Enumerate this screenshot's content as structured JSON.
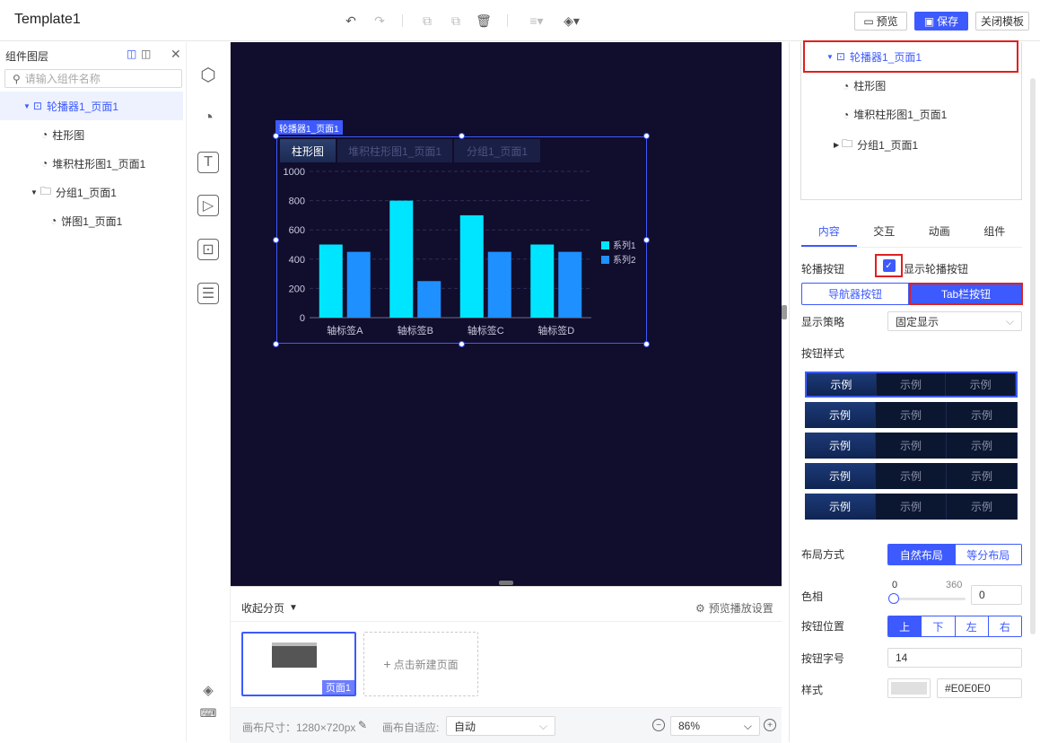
{
  "app": {
    "title": "Template1"
  },
  "topbar": {
    "preview_label": "预览",
    "save_label": "保存",
    "close_label": "关闭模板"
  },
  "leftpanel": {
    "title": "组件图层",
    "search_placeholder": "请输入组件名称",
    "tree": [
      {
        "label": "轮播器1_页面1"
      },
      {
        "label": "柱形图"
      },
      {
        "label": "堆积柱形图1_页面1"
      },
      {
        "label": "分组1_页面1"
      },
      {
        "label": "饼图1_页面1"
      }
    ]
  },
  "canvas": {
    "component_tag": "轮播器1_页面1",
    "tabs": [
      "柱形图",
      "堆积柱形图1_页面1",
      "分组1_页面1"
    ]
  },
  "chart_data": {
    "type": "bar",
    "categories": [
      "轴标签A",
      "轴标签B",
      "轴标签C",
      "轴标签D"
    ],
    "series": [
      {
        "name": "系列1",
        "values": [
          500,
          800,
          700,
          500
        ],
        "color": "#00e5ff"
      },
      {
        "name": "系列2",
        "values": [
          450,
          250,
          450,
          450
        ],
        "color": "#1e90ff"
      }
    ],
    "yticks": [
      "0",
      "200",
      "400",
      "600",
      "800",
      "1000"
    ],
    "ylim": [
      0,
      1000
    ],
    "legend": "right",
    "grid": true
  },
  "pages": {
    "collapse_label": "收起分页",
    "settings_label": "预览播放设置",
    "page_label": "页面1",
    "new_page_label": "点击新建页面"
  },
  "footer": {
    "canvas_size_label": "画布尺寸：1280×720px",
    "adapt_label": "画布自适应:",
    "adapt_value": "自动",
    "zoom_value": "86%"
  },
  "rightpanel": {
    "tree": [
      {
        "label": "轮播器1_页面1"
      },
      {
        "label": "柱形图"
      },
      {
        "label": "堆积柱形图1_页面1"
      },
      {
        "label": "分组1_页面1"
      }
    ],
    "tabs": [
      "内容",
      "交互",
      "动画",
      "组件"
    ],
    "carousel_btn_label": "轮播按钮",
    "show_btn_label": "显示轮播按钮",
    "btn_type": [
      "导航器按钮",
      "Tab栏按钮"
    ],
    "strategy_label": "显示策略",
    "strategy_value": "固定显示",
    "btn_style_label": "按钮样式",
    "style_sample": [
      "示例",
      "示例",
      "示例"
    ],
    "layout_label": "布局方式",
    "layout_opts": [
      "自然布局",
      "等分布局"
    ],
    "hue_label": "色相",
    "hue_min": "0",
    "hue_max": "360",
    "hue_value": "0",
    "btn_pos_label": "按钮位置",
    "btn_pos_opts": [
      "上",
      "下",
      "左",
      "右"
    ],
    "font_size_label": "按钮字号",
    "font_size_value": "14",
    "style_label": "样式",
    "style_color": "#E0E0E0"
  },
  "colors": {
    "accent": "#3d5afe",
    "canvas_bg": "#110d2c",
    "highlight": "#e02020"
  }
}
